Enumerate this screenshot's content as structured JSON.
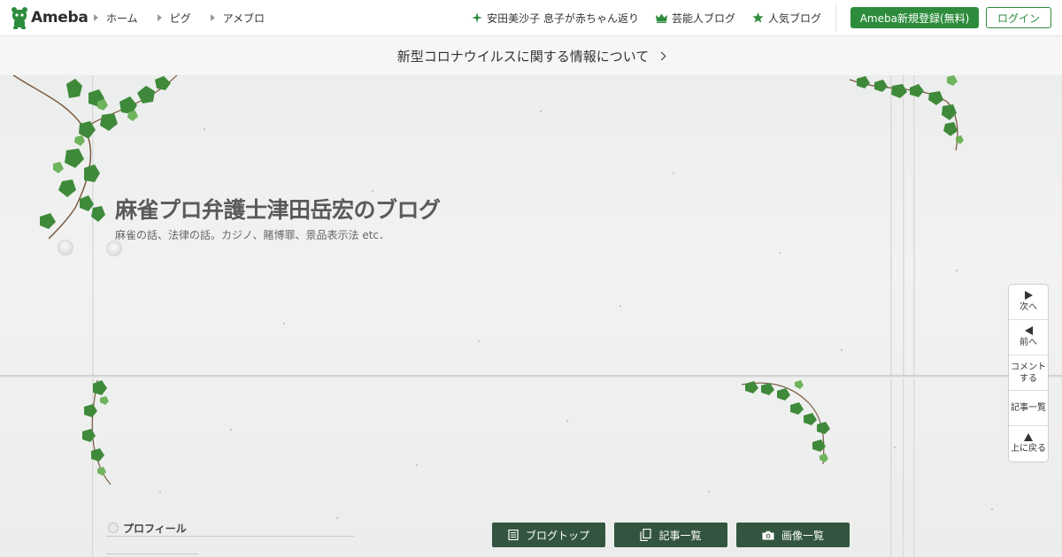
{
  "header": {
    "logo_text": "Ameba",
    "nav": [
      {
        "label": "ホーム"
      },
      {
        "label": "ピグ"
      },
      {
        "label": "アメブロ"
      }
    ],
    "topics": [
      {
        "label": "安田美沙子 息子が赤ちゃん返り",
        "icon": "sparkle-icon"
      },
      {
        "label": "芸能人ブログ",
        "icon": "crown-icon"
      },
      {
        "label": "人気ブログ",
        "icon": "star-icon"
      }
    ],
    "register_label": "Ameba新規登録(無料)",
    "login_label": "ログイン"
  },
  "notice": {
    "text": "新型コロナウイルスに関する情報について"
  },
  "blog": {
    "title": "麻雀プロ弁護士津田岳宏のブログ",
    "description": "麻雀の話、法律の話。カジノ、賭博罪、景品表示法 etc．"
  },
  "side_nav": {
    "next": "次へ",
    "prev": "前へ",
    "comment_line1": "コメント",
    "comment_line2": "する",
    "list": "記事一覧",
    "top": "上に戻る"
  },
  "profile": {
    "label": "プロフィール"
  },
  "bottom_buttons": [
    {
      "label": "ブログトップ",
      "icon": "document-icon"
    },
    {
      "label": "記事一覧",
      "icon": "copy-icon"
    },
    {
      "label": "画像一覧",
      "icon": "camera-icon"
    }
  ],
  "colors": {
    "brand_green": "#2d8c3c",
    "button_dark_green": "#33553f",
    "ivy_green": "#3f8a3a"
  }
}
